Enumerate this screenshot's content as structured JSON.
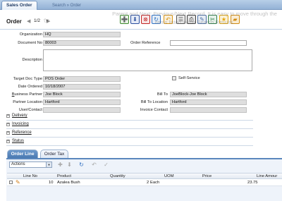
{
  "tabs": {
    "active": "Sales Order",
    "breadcrumb": "Search » Order"
  },
  "header": {
    "title": "Order",
    "prev_icon": "chevron-left-icon",
    "page": "1/2",
    "next_icon": "chevron-right-icon",
    "cursor_icon": "hand-cursor-icon"
  },
  "toolbar": [
    {
      "name": "new-record-icon",
      "glyph": "➕",
      "color": "#3d8a2e",
      "bg": "#e8f2e4"
    },
    {
      "name": "save-icon",
      "glyph": "⬇",
      "color": "#2b4f9e",
      "bg": "#e4eaf6"
    },
    {
      "name": "delete-icon",
      "glyph": "⊗",
      "color": "#c22222",
      "bg": "#f7e4e4"
    },
    {
      "name": "refresh-icon",
      "glyph": "↻",
      "color": "#2f6fc2",
      "bg": "#e4eef8"
    },
    {
      "name": "undo-icon",
      "glyph": "↶",
      "color": "#d9920e",
      "bg": "#f9f0dd"
    },
    {
      "name": "report-icon",
      "glyph": "☰",
      "color": "#555555",
      "bg": "#ececec"
    },
    {
      "name": "print-icon",
      "glyph": "⎙",
      "color": "#3a3a3a",
      "bg": "#e6e6e6"
    },
    {
      "name": "edit-icon",
      "glyph": "✎",
      "color": "#4a6fa5",
      "bg": "#e6ecf4"
    },
    {
      "name": "attach-icon",
      "glyph": "✂",
      "color": "#2e7d4a",
      "bg": "#e4f1e8"
    },
    {
      "name": "help-icon",
      "glyph": "★",
      "color": "#e4a60b",
      "bg": "#fbf1d6"
    },
    {
      "name": "folder-icon",
      "glyph": "▰",
      "color": "#d18b12",
      "bg": "#f9ecd3"
    }
  ],
  "tooltip_text": "Parent and Next: Previous/Next Record. It is easy to move through the items listed in the Search Results.",
  "form": {
    "organization": {
      "label": "Organization",
      "value": "HQ"
    },
    "document_no": {
      "label": "Document No",
      "value": "80003"
    },
    "order_reference": {
      "label": "Order Reference",
      "value": ""
    },
    "description": {
      "label": "Description",
      "value": ""
    },
    "target_doc_type": {
      "label": "Target Doc Type",
      "value": "POS Order"
    },
    "self_service": {
      "label": "Self-Service",
      "checked": false
    },
    "date_ordered": {
      "label": "Date Ordered",
      "value": "10/18/2007"
    },
    "business_partner": {
      "label_u": "B",
      "label_rest": "usiness Partner",
      "value": "Joe Block"
    },
    "bill_to": {
      "label": "Bill To",
      "value": "JoeBlock-Joe Block"
    },
    "partner_location": {
      "label": "Partner Location",
      "value": "Hartford"
    },
    "bill_to_location": {
      "label": "Bill To Location",
      "value": "Hartford"
    },
    "user_contact": {
      "label": "User/Contact",
      "value": ""
    },
    "invoice_contact": {
      "label": "Invoice Contact",
      "value": ""
    }
  },
  "sections": [
    {
      "name": "section-delivery",
      "label": "Delivery"
    },
    {
      "name": "section-invoicing",
      "label": "Invoicing"
    },
    {
      "name": "section-reference",
      "label": "Reference"
    },
    {
      "name": "section-status",
      "label": "Status"
    }
  ],
  "bottom_tabs": {
    "active": "Order Line",
    "inactive": "Order Tax"
  },
  "grid": {
    "actions_label": "Actions",
    "toolbar": [
      {
        "name": "grid-new-icon",
        "glyph": "✚",
        "color": "#aaaaaa"
      },
      {
        "name": "grid-save-icon",
        "glyph": "⬇",
        "color": "#aaaaaa"
      },
      {
        "name": "grid-refresh-icon",
        "glyph": "↻",
        "color": "#2f6fc2"
      },
      {
        "name": "grid-undo-icon",
        "glyph": "↶",
        "color": "#aaaaaa"
      },
      {
        "name": "grid-export-icon",
        "glyph": "✓",
        "color": "#aaaaaa"
      }
    ],
    "columns": [
      "Line No",
      "Product",
      "Quantity",
      "UOM",
      "Price",
      "Line Amour"
    ],
    "rows": [
      {
        "line_no": "10",
        "product": "Azalea Bush",
        "quantity": "2",
        "uom": "Each",
        "price": "23.75",
        "line_amount": ""
      }
    ]
  }
}
